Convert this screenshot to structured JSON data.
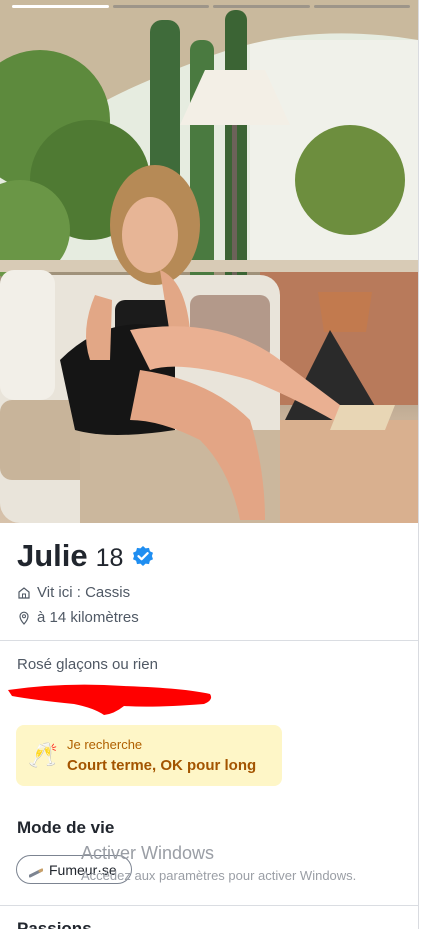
{
  "profile": {
    "name": "Julie",
    "age": "18",
    "lives_in": "Vit ici : Cassis",
    "distance": "à 14 kilomètres",
    "bio": "Rosé glaçons ou rien"
  },
  "photo": {
    "count": 4,
    "current_index": 1
  },
  "looking_for": {
    "emoji": "🥂",
    "label": "Je recherche",
    "value": "Court terme, OK pour long"
  },
  "lifestyle": {
    "title": "Mode de vie",
    "chips": [
      "Fumeur·se"
    ]
  },
  "passions": {
    "title": "Passions"
  },
  "os_watermark": {
    "line1": "Activer Windows",
    "line2": "Accédez aux paramètres pour activer Windows."
  },
  "colors": {
    "verified": "#1f8ef1",
    "looking_bg": "#fef6c7",
    "looking_text": "#a35400",
    "redaction": "#ff0000"
  }
}
